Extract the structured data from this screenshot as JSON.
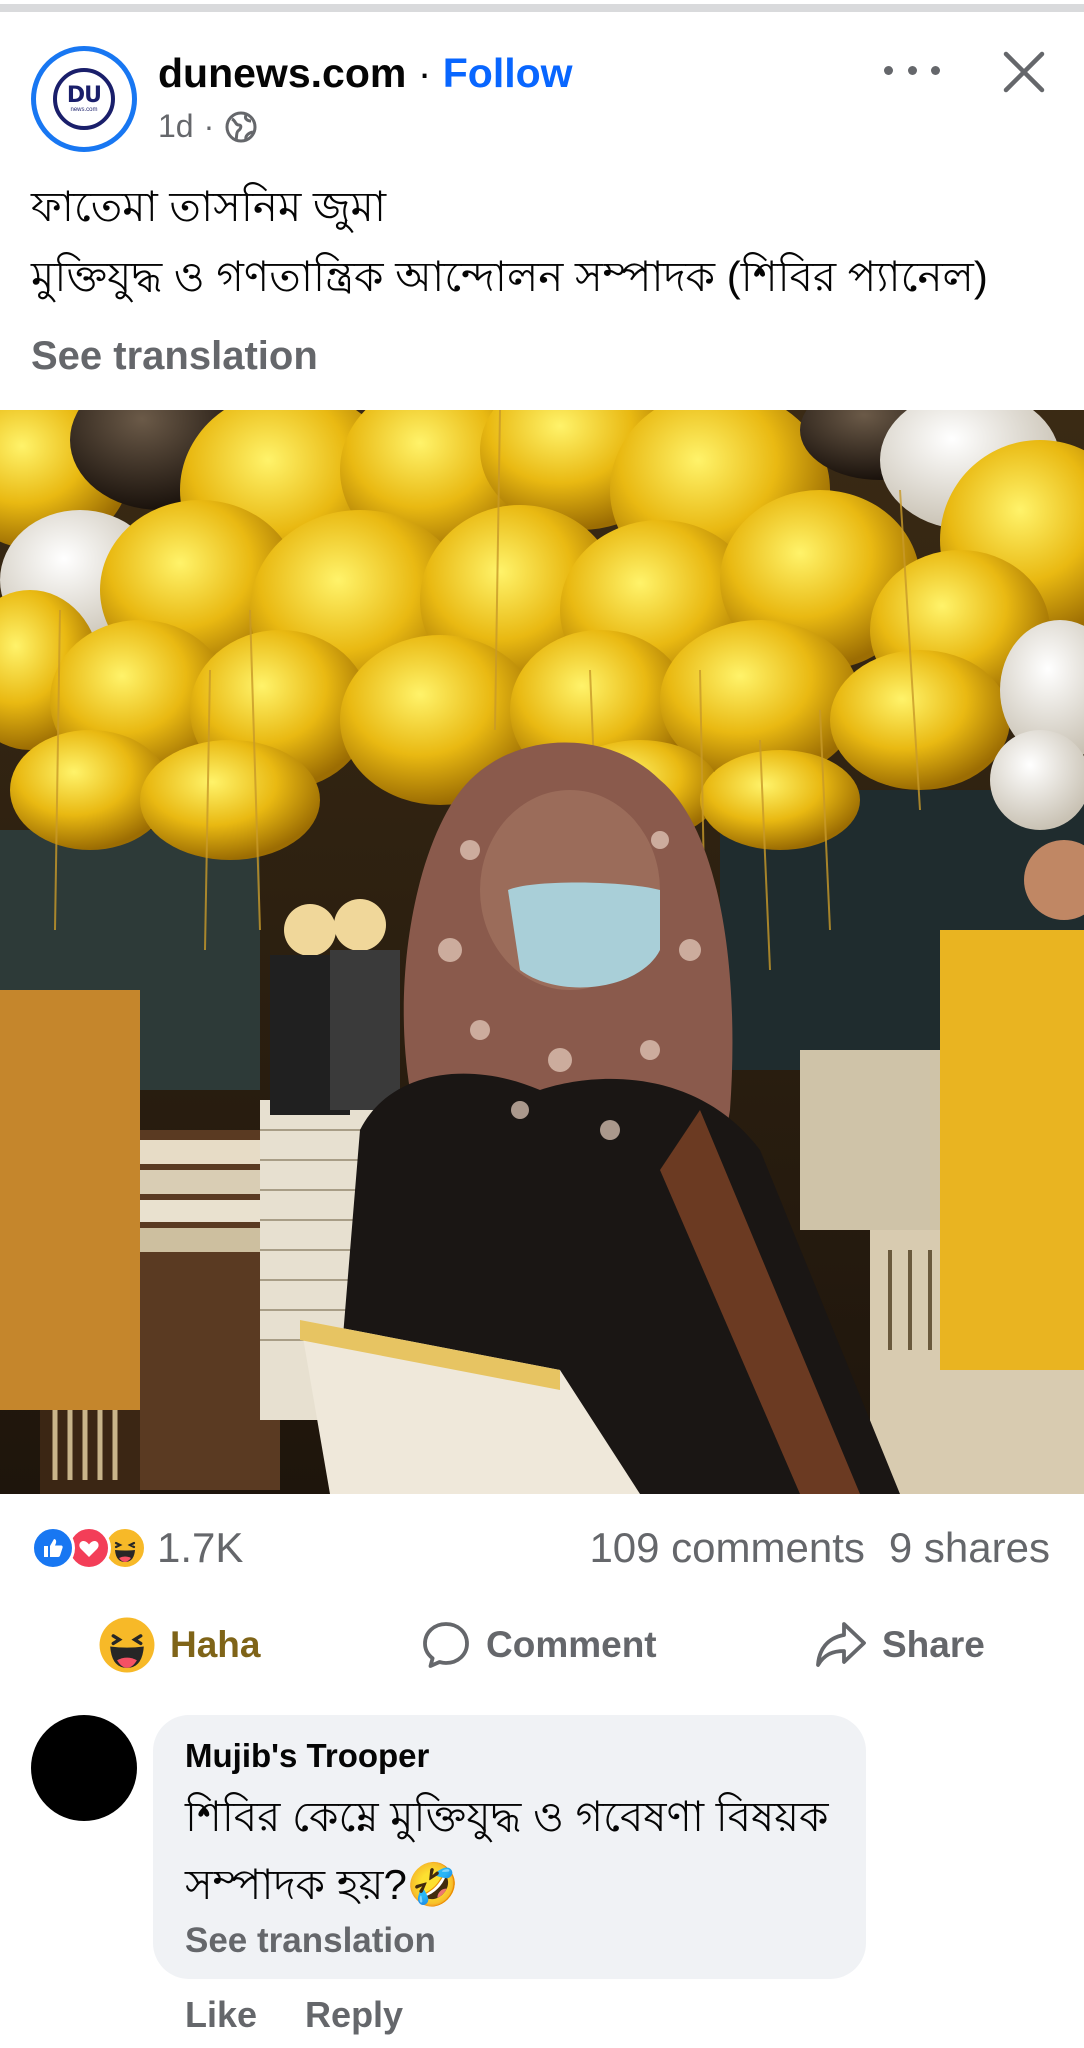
{
  "header": {
    "avatar_mark": "DU",
    "avatar_sub": "news.com",
    "page_name": "dunews.com",
    "separator": " · ",
    "follow_label": "Follow",
    "time": "1d",
    "time_separator": "·",
    "privacy_icon": "globe-icon",
    "more_icon": "more-horizontal-icon",
    "close_icon": "close-icon"
  },
  "post": {
    "line1": "ফাতেমা তাসনিম জুমা",
    "line2": "মুক্তিযুদ্ধ ও গণতান্ত্রিক আন্দোলন সম্পাদক (শিবির প্যানেল)",
    "see_translation": "See translation",
    "photo_icon": "post-photo"
  },
  "engagement": {
    "reaction_icons": [
      "like-icon",
      "love-icon",
      "haha-icon"
    ],
    "reaction_count": "1.7K",
    "comments": "109 comments",
    "shares": "9 shares"
  },
  "actions": {
    "haha_label": "Haha",
    "comment_label": "Comment",
    "share_label": "Share"
  },
  "comment": {
    "author": "Mujib's Trooper",
    "text_line1": "শিবির কেম্নে মুক্তিযুদ্ধ ও গবেষণা বিষয়ক",
    "text_line2": "সম্পাদক হয়?🤣",
    "see_translation": "See translation",
    "like_label": "Like",
    "reply_label": "Reply"
  },
  "colors": {
    "accent": "#0866ff",
    "secondary_text": "#65676b",
    "haha_text": "#7f6418",
    "bubble": "#f0f2f5"
  }
}
